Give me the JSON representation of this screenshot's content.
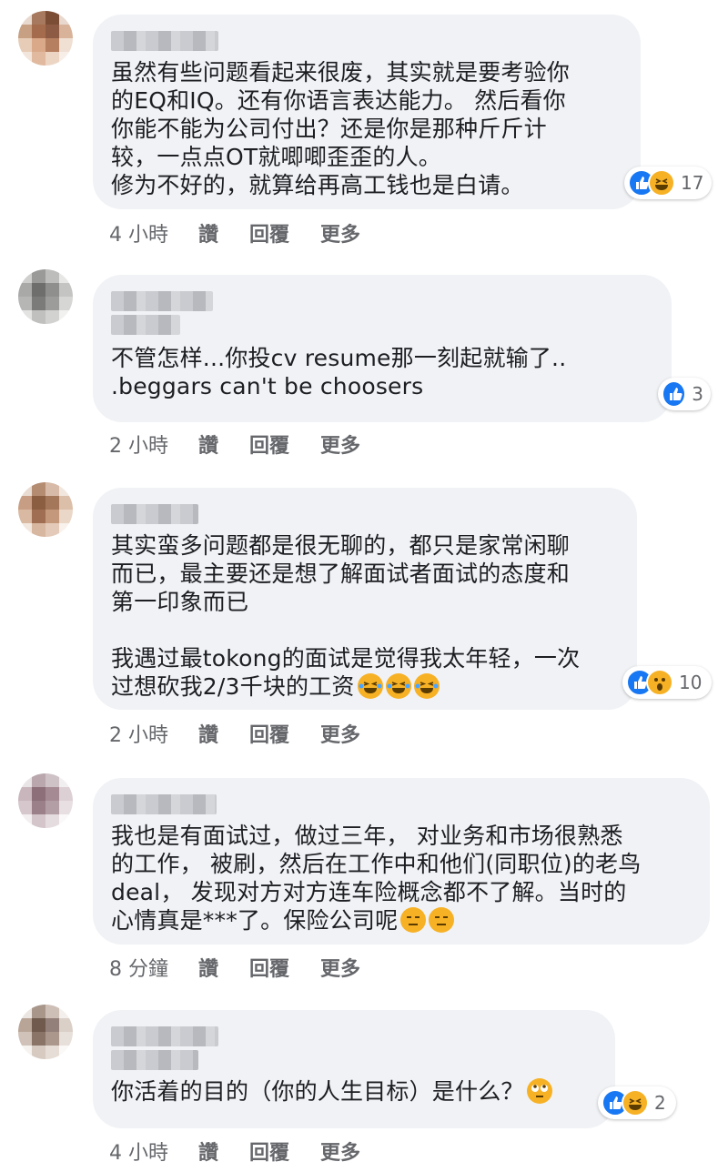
{
  "comments": [
    {
      "text": "虽然有些问题看起来很废，其实就是要考验你\n的EQ和IQ。还有你语言表达能力。 然后看你\n你能不能为公司付出？还是你是那种斤斤计\n较，一点点OT就唧唧歪歪的人。\n修为不好的，就算给再高工钱也是白请。",
      "reaction_count": "17",
      "reactions": [
        "like-icon",
        "haha-icon"
      ],
      "time": "4 小時",
      "like_label": "讚",
      "reply_label": "回覆",
      "more_label": "更多"
    },
    {
      "text": "不管怎样...你投cv resume那一刻起就输了..\n.beggars can't be choosers",
      "reaction_count": "3",
      "reactions": [
        "like-icon"
      ],
      "time": "2 小時",
      "like_label": "讚",
      "reply_label": "回覆",
      "more_label": "更多"
    },
    {
      "text": "其实蛮多问题都是很无聊的，都只是家常闲聊\n而已，最主要还是想了解面试者面试的态度和\n第一印象而已\n\n我遇过最tokong的面试是觉得我太年轻，一次\n过想砍我2/3千块的工资",
      "text_emojis": [
        "tears-of-joy-emoji",
        "tears-of-joy-emoji",
        "tears-of-joy-emoji"
      ],
      "reaction_count": "10",
      "reactions": [
        "like-icon",
        "wow-icon"
      ],
      "time": "2 小時",
      "like_label": "讚",
      "reply_label": "回覆",
      "more_label": "更多"
    },
    {
      "text": "我也是有面试过，做过三年， 对业务和市场很熟悉\n的工作， 被刷，然后在工作中和他们(同职位)的老鸟\ndeal， 发现对方对方连车险概念都不了解。当时的\n心情真是***了。保险公司呢",
      "text_emojis": [
        "expressionless-emoji",
        "expressionless-emoji"
      ],
      "time": "8 分鐘",
      "like_label": "讚",
      "reply_label": "回覆",
      "more_label": "更多"
    },
    {
      "text": "你活着的目的（你的人生目标）是什么？",
      "text_emojis": [
        "eye-roll-emoji"
      ],
      "reaction_count": "2",
      "reactions": [
        "like-icon",
        "haha-icon"
      ],
      "time": "4 小時",
      "like_label": "讚",
      "reply_label": "回覆",
      "more_label": "更多"
    }
  ],
  "colors": {
    "bubble": "#f0f2f5",
    "like_blue": "#1877f2",
    "emoji_yellow": "#f7b125",
    "meta_gray": "#65676b",
    "text": "#1c1e21"
  }
}
